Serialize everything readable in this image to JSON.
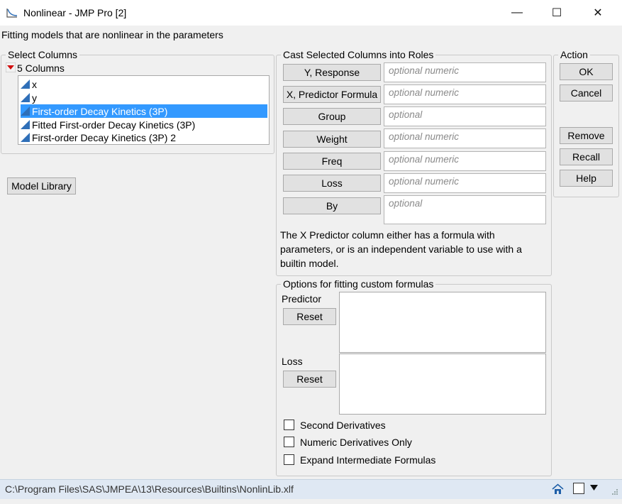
{
  "window": {
    "title": "Nonlinear - JMP Pro [2]",
    "controls": {
      "minimize": "—",
      "maximize": "☐",
      "close": "✕"
    }
  },
  "subtitle": "Fitting models that are nonlinear in the parameters",
  "select_columns": {
    "legend": "Select Columns",
    "count_label": "5 Columns",
    "columns": [
      {
        "name": "x",
        "selected": false
      },
      {
        "name": "y",
        "selected": false
      },
      {
        "name": "First-order Decay Kinetics (3P)",
        "selected": true
      },
      {
        "name": "Fitted First-order Decay Kinetics (3P)",
        "selected": false
      },
      {
        "name": "First-order Decay Kinetics (3P) 2",
        "selected": false
      }
    ]
  },
  "model_library_label": "Model Library",
  "cast_roles": {
    "legend": "Cast Selected Columns into Roles",
    "roles": [
      {
        "label": "Y, Response",
        "placeholder": "optional numeric"
      },
      {
        "label": "X, Predictor Formula",
        "placeholder": "optional numeric"
      },
      {
        "label": "Group",
        "placeholder": "optional"
      },
      {
        "label": "Weight",
        "placeholder": "optional numeric"
      },
      {
        "label": "Freq",
        "placeholder": "optional numeric"
      },
      {
        "label": "Loss",
        "placeholder": "optional numeric"
      },
      {
        "label": "By",
        "placeholder": "optional"
      }
    ],
    "note": "The X Predictor column either has a formula with parameters, or is an independent variable to use with a builtin model."
  },
  "action": {
    "legend": "Action",
    "ok": "OK",
    "cancel": "Cancel",
    "remove": "Remove",
    "recall": "Recall",
    "help": "Help"
  },
  "options": {
    "legend": "Options for fitting custom formulas",
    "predictor_label": "Predictor",
    "loss_label": "Loss",
    "reset_label": "Reset",
    "checkboxes": [
      {
        "label": "Second Derivatives",
        "checked": false
      },
      {
        "label": "Numeric Derivatives Only",
        "checked": false
      },
      {
        "label": "Expand Intermediate Formulas",
        "checked": false
      }
    ]
  },
  "status": {
    "path": "C:\\Program Files\\SAS\\JMPEA\\13\\Resources\\Builtins\\NonlinLib.xlf"
  },
  "colors": {
    "selection": "#3399ff",
    "column_icon": "#2f6fb8",
    "red_triangle": "#d10f0f",
    "status_bar": "#dfe8f3"
  }
}
